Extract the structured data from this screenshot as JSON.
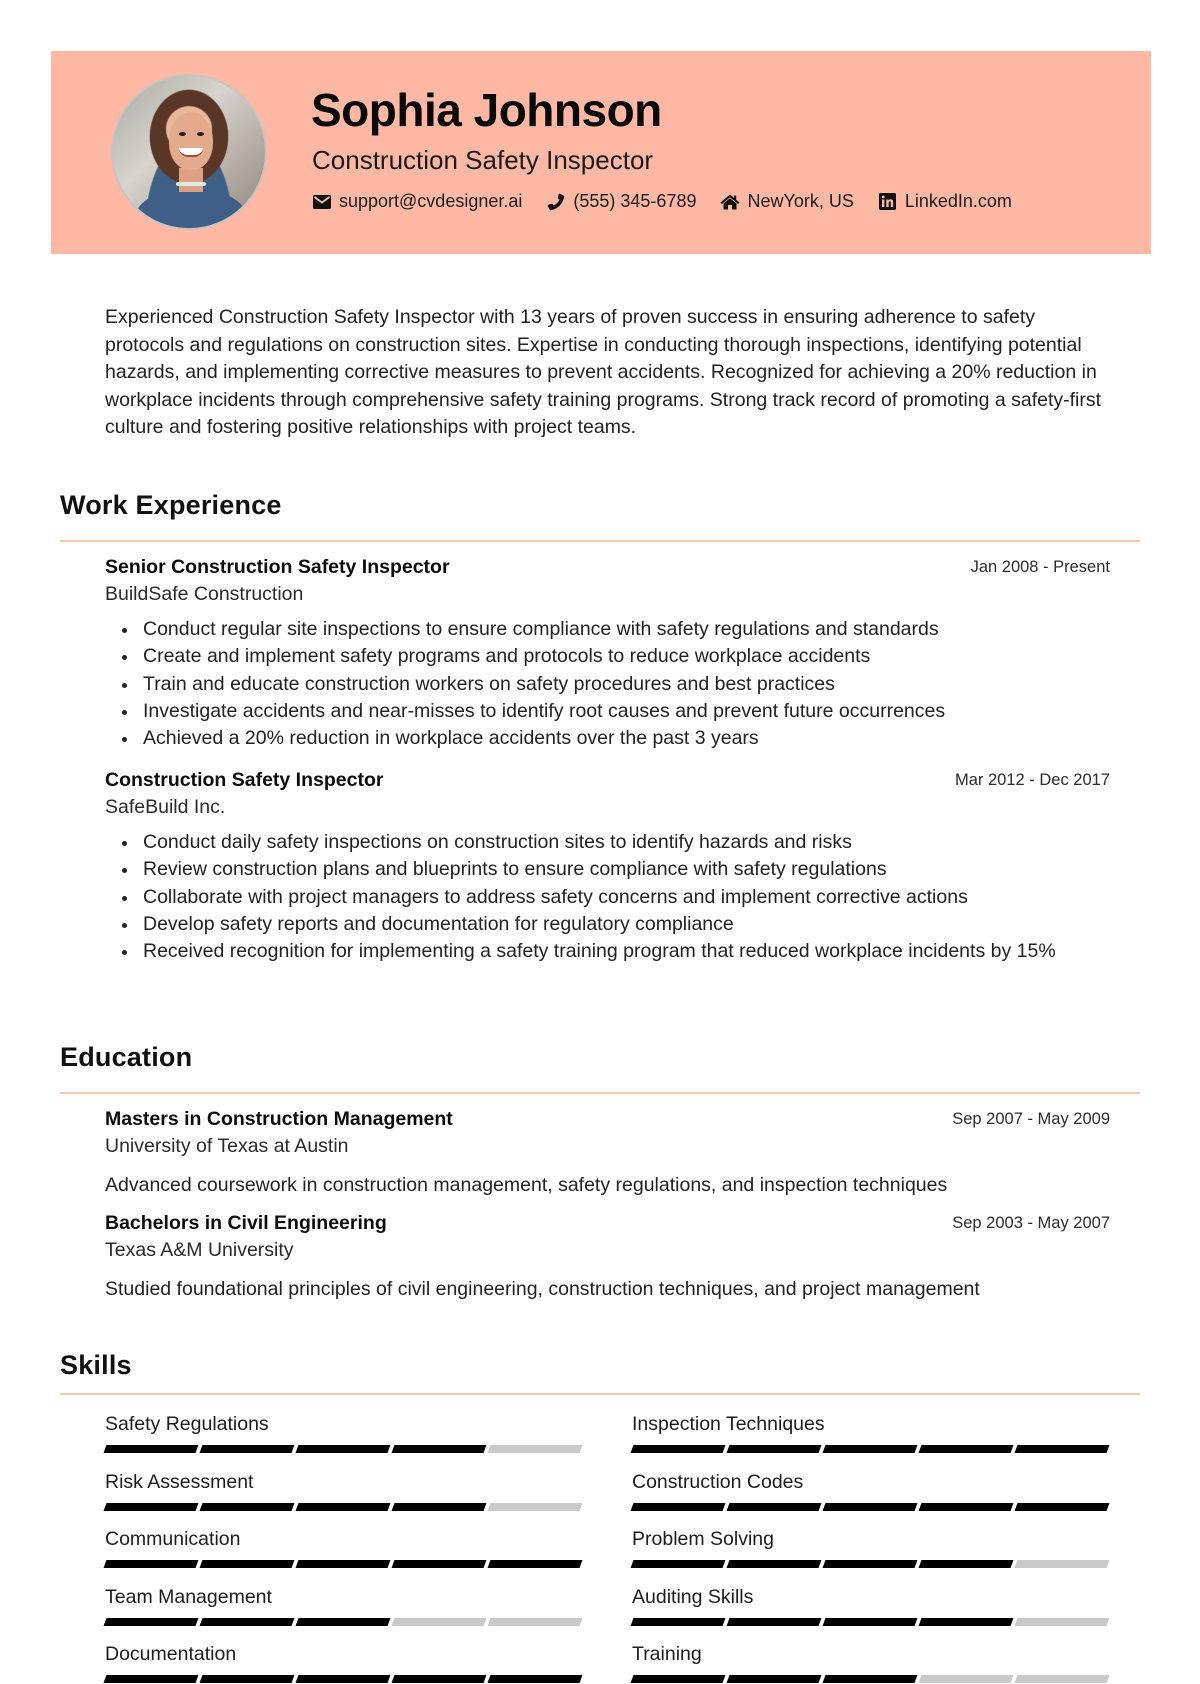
{
  "header": {
    "name": "Sophia Johnson",
    "title": "Construction Safety Inspector",
    "background_color": "#FFB8A3",
    "contacts": [
      {
        "icon": "envelope-icon",
        "text": "support@cvdesigner.ai"
      },
      {
        "icon": "phone-icon",
        "text": "(555) 345-6789"
      },
      {
        "icon": "home-icon",
        "text": "NewYork, US"
      },
      {
        "icon": "linkedin-icon",
        "text": "LinkedIn.com"
      }
    ]
  },
  "summary": "Experienced Construction Safety Inspector with 13 years of proven success in ensuring adherence to safety protocols and regulations on construction sites. Expertise in conducting thorough inspections, identifying potential hazards, and implementing corrective measures to prevent accidents. Recognized for achieving a 20% reduction in workplace incidents through comprehensive safety training programs. Strong track record of promoting a safety-first culture and fostering positive relationships with project teams.",
  "sections": {
    "work_experience": "Work Experience",
    "education": "Education",
    "skills": "Skills",
    "divider_color": "#FFC4B0"
  },
  "work_experience": [
    {
      "title": "Senior Construction Safety Inspector",
      "company": "BuildSafe Construction",
      "dates": "Jan 2008 - Present",
      "bullets": [
        "Conduct regular site inspections to ensure compliance with safety regulations and standards",
        "Create and implement safety programs and protocols to reduce workplace accidents",
        "Train and educate construction workers on safety procedures and best practices",
        "Investigate accidents and near-misses to identify root causes and prevent future occurrences",
        "Achieved a 20% reduction in workplace accidents over the past 3 years"
      ]
    },
    {
      "title": "Construction Safety Inspector",
      "company": "SafeBuild Inc.",
      "dates": "Mar 2012 - Dec 2017",
      "bullets": [
        "Conduct daily safety inspections on construction sites to identify hazards and risks",
        "Review construction plans and blueprints to ensure compliance with safety regulations",
        "Collaborate with project managers to address safety concerns and implement corrective actions",
        "Develop safety reports and documentation for regulatory compliance",
        "Received recognition for implementing a safety training program that reduced workplace incidents by 15%"
      ]
    }
  ],
  "education": [
    {
      "degree": "Masters in Construction Management",
      "school": "University of Texas at Austin",
      "dates": "Sep 2007 - May 2009",
      "description": "Advanced coursework in construction management, safety regulations, and inspection techniques"
    },
    {
      "degree": "Bachelors in Civil Engineering",
      "school": "Texas A&M University",
      "dates": "Sep 2003 - May 2007",
      "description": "Studied foundational principles of civil engineering, construction techniques, and project management"
    }
  ],
  "skills": [
    {
      "name": "Safety Regulations",
      "level": 4,
      "max": 5
    },
    {
      "name": "Inspection Techniques",
      "level": 5,
      "max": 5
    },
    {
      "name": "Risk Assessment",
      "level": 4,
      "max": 5
    },
    {
      "name": "Construction Codes",
      "level": 5,
      "max": 5
    },
    {
      "name": "Communication",
      "level": 5,
      "max": 5
    },
    {
      "name": "Problem Solving",
      "level": 4,
      "max": 5
    },
    {
      "name": "Team Management",
      "level": 3,
      "max": 5
    },
    {
      "name": "Auditing Skills",
      "level": 4,
      "max": 5
    },
    {
      "name": "Documentation",
      "level": 5,
      "max": 5
    },
    {
      "name": "Training",
      "level": 3,
      "max": 5
    }
  ]
}
